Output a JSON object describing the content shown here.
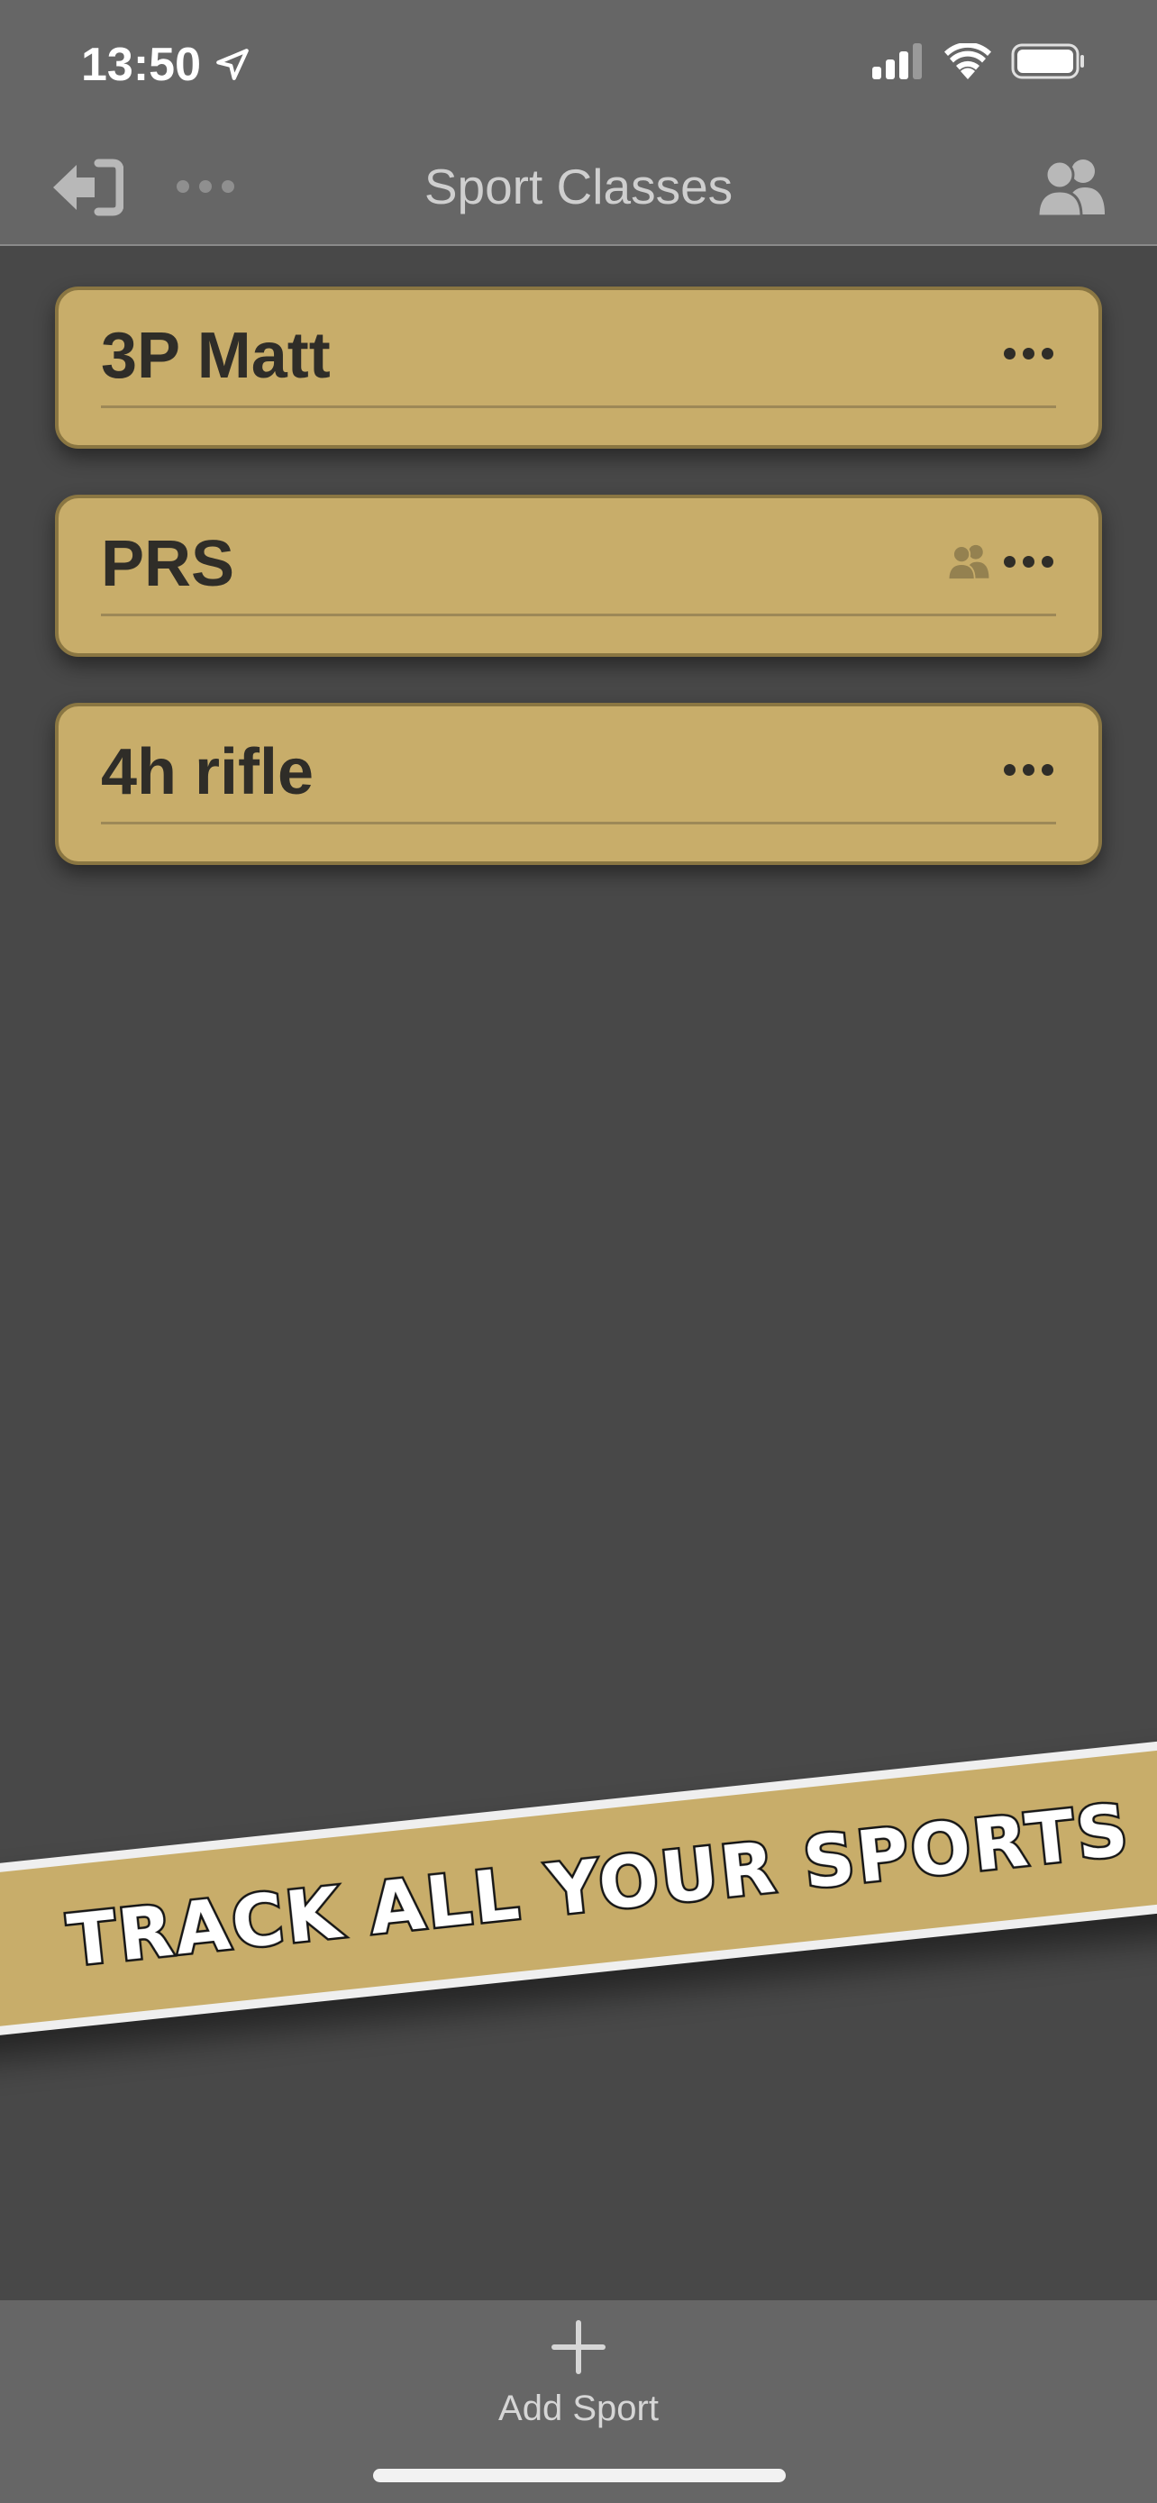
{
  "status_bar": {
    "time": "13:50",
    "location_icon": "location-arrow-icon",
    "signal_icon": "cellular-signal-icon",
    "wifi_icon": "wifi-icon",
    "battery_icon": "battery-full-icon"
  },
  "nav": {
    "title": "Sport Classes",
    "back_icon": "sign-out-icon",
    "more_icon": "ellipsis-icon",
    "people_icon": "people-icon"
  },
  "sports": [
    {
      "name": "3P Matt",
      "shared": false
    },
    {
      "name": "PRS",
      "shared": true
    },
    {
      "name": "4h rifle",
      "shared": false
    }
  ],
  "banner": {
    "text": "TRACK ALL YOUR SPORTS"
  },
  "bottom": {
    "add_label": "Add Sport",
    "add_icon": "plus-icon"
  },
  "colors": {
    "card": "#c8ad6a",
    "card_border": "#8a7642",
    "background": "#484848",
    "bar": "#666666"
  }
}
